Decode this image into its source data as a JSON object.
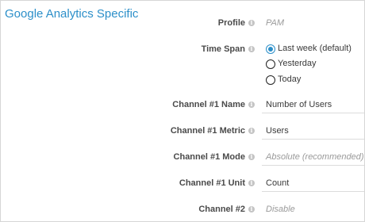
{
  "section": {
    "title": "Google Analytics Specific"
  },
  "info_glyph": "i",
  "fields": {
    "profile": {
      "label": "Profile",
      "value": "PAM"
    },
    "time_span": {
      "label": "Time Span",
      "options": [
        "Last week (default)",
        "Yesterday",
        "Today"
      ],
      "selected": "Last week (default)"
    },
    "channel1_name": {
      "label": "Channel #1 Name",
      "value": "Number of Users"
    },
    "channel1_metric": {
      "label": "Channel #1 Metric",
      "value": "Users"
    },
    "channel1_mode": {
      "label": "Channel #1 Mode",
      "value": "Absolute (recommended)"
    },
    "channel1_unit": {
      "label": "Channel #1 Unit",
      "value": "Count"
    },
    "channel2": {
      "label": "Channel #2",
      "value": "Disable"
    }
  },
  "colors": {
    "accent": "#2c8fc9",
    "label": "#4a4a4a",
    "placeholder": "#9a9a9a"
  },
  "icons": {
    "info": "info-circle-icon",
    "radio": "radio-button-icon"
  }
}
